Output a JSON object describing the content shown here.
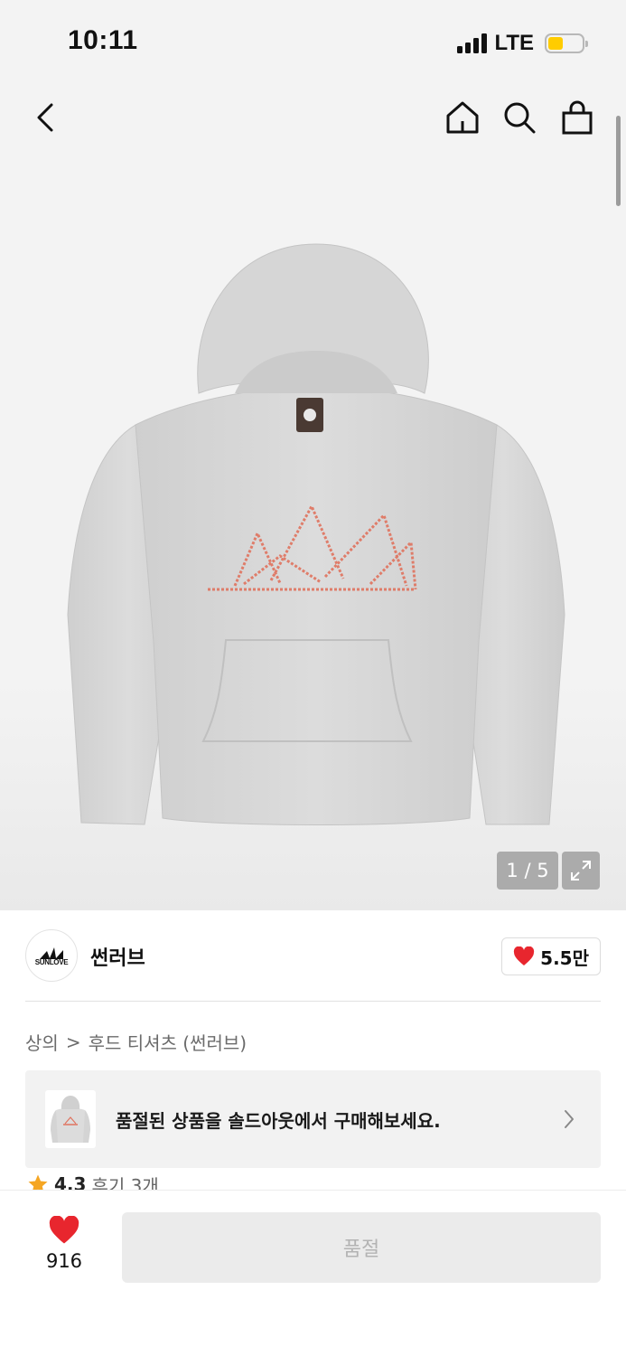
{
  "status_bar": {
    "time": "10:11",
    "network": "LTE",
    "battery_level": 0.3,
    "battery_color": "#ffcc00"
  },
  "nav": {
    "back_icon": "chevron-left-icon",
    "home_icon": "home-icon",
    "search_icon": "search-icon",
    "cart_icon": "shopping-bag-icon"
  },
  "gallery": {
    "counter": "1 / 5",
    "current_page": 1,
    "total_pages": 5,
    "expand_icon": "expand-icon"
  },
  "brand": {
    "name": "썬러브",
    "logo_text": "SUNLOVE",
    "likes": "5.5만",
    "heart_color": "#e8262e"
  },
  "breadcrumb": {
    "category": "상의",
    "separator": ">",
    "subcategory": "후드 티셔츠 (썬러브)"
  },
  "soldout_banner": {
    "text": "품절된 상품을 솔드아웃에서 구매해보세요.",
    "chevron_icon": "chevron-right-icon"
  },
  "rating": {
    "score": "4.3",
    "reviews": "후기 3개",
    "star_color": "#f5a623"
  },
  "bottom_bar": {
    "wish_count": "916",
    "buy_label": "품절"
  }
}
